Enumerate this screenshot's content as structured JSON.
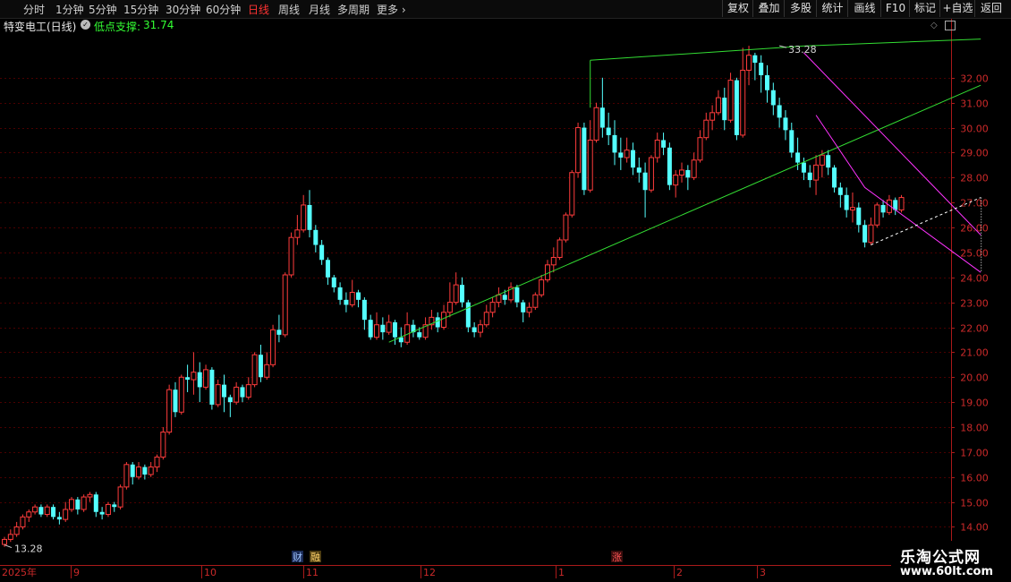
{
  "periods": [
    {
      "label": "分时",
      "active": false
    },
    {
      "label": "1分钟",
      "active": false
    },
    {
      "label": "5分钟",
      "active": false
    },
    {
      "label": "15分钟",
      "active": false
    },
    {
      "label": "30分钟",
      "active": false
    },
    {
      "label": "60分钟",
      "active": false
    },
    {
      "label": "日线",
      "active": true
    },
    {
      "label": "周线",
      "active": false
    },
    {
      "label": "月线",
      "active": false
    },
    {
      "label": "多周期",
      "active": false
    },
    {
      "label": "更多",
      "active": false
    }
  ],
  "toolbar": [
    "复权",
    "叠加",
    "多股",
    "统计",
    "画线",
    "F10",
    "标记",
    "+自选",
    "返回"
  ],
  "title": {
    "stock": "特变电工(日线)",
    "indicator_label": "低点支撑:",
    "indicator_value": "31.74"
  },
  "colors": {
    "up": "#ff3c3c",
    "down": "#54ffff",
    "trend": "#33dd33",
    "channel": "#ff33ff",
    "grid": "#4a0000",
    "axis": "#aa1a1a",
    "axis_text": "#cc2a2a",
    "active_period": "#ff3333"
  },
  "annotations": {
    "high_label": "33.28",
    "low_label": "13.28",
    "event_cai": "财",
    "event_rong": "融",
    "event_zhang": "涨"
  },
  "watermark": {
    "line1": "乐淘公式网",
    "line2": "www.60lt.com"
  },
  "chart_data": {
    "type": "candlestick",
    "ylim": [
      13.3,
      33.5
    ],
    "yticks": [
      14.0,
      15.0,
      16.0,
      17.0,
      18.0,
      19.0,
      20.0,
      21.0,
      22.0,
      23.0,
      24.0,
      25.0,
      26.0,
      27.0,
      28.0,
      29.0,
      30.0,
      31.0,
      32.0
    ],
    "x_labels": [
      "2025年",
      "9",
      "10",
      "11",
      "12",
      "1",
      "2",
      "3"
    ],
    "high": 33.28,
    "low": 13.28,
    "candles": [
      [
        13.3,
        13.5,
        13.2,
        13.6
      ],
      [
        13.5,
        13.7,
        13.4,
        13.9
      ],
      [
        13.7,
        14.0,
        13.6,
        14.2
      ],
      [
        14.0,
        14.4,
        13.9,
        14.5
      ],
      [
        14.4,
        14.6,
        14.2,
        14.7
      ],
      [
        14.6,
        14.8,
        14.5,
        14.9
      ],
      [
        14.8,
        14.5,
        14.4,
        14.9
      ],
      [
        14.5,
        14.8,
        14.4,
        14.9
      ],
      [
        14.8,
        14.4,
        14.3,
        14.9
      ],
      [
        14.4,
        14.3,
        14.1,
        14.6
      ],
      [
        14.3,
        14.7,
        14.2,
        15.0
      ],
      [
        14.7,
        15.1,
        14.6,
        15.2
      ],
      [
        15.1,
        14.7,
        14.5,
        15.2
      ],
      [
        14.7,
        15.2,
        14.6,
        15.3
      ],
      [
        15.2,
        15.3,
        15.0,
        15.4
      ],
      [
        15.3,
        14.6,
        14.4,
        15.4
      ],
      [
        14.6,
        14.5,
        14.3,
        14.8
      ],
      [
        14.5,
        14.9,
        14.4,
        15.0
      ],
      [
        14.9,
        14.8,
        14.6,
        15.0
      ],
      [
        14.8,
        15.6,
        14.7,
        15.7
      ],
      [
        15.6,
        16.5,
        15.5,
        16.6
      ],
      [
        16.5,
        16.0,
        15.7,
        16.6
      ],
      [
        16.0,
        16.4,
        15.9,
        16.6
      ],
      [
        16.4,
        16.1,
        15.9,
        16.5
      ],
      [
        16.1,
        16.4,
        16.0,
        16.6
      ],
      [
        16.4,
        16.8,
        16.2,
        16.9
      ],
      [
        16.8,
        17.8,
        16.7,
        18.0
      ],
      [
        17.8,
        19.5,
        17.7,
        19.7
      ],
      [
        19.5,
        18.6,
        18.4,
        19.8
      ],
      [
        18.6,
        20.0,
        18.5,
        20.1
      ],
      [
        20.0,
        19.9,
        19.4,
        20.5
      ],
      [
        19.9,
        20.2,
        19.3,
        21.0
      ],
      [
        20.2,
        19.6,
        19.0,
        20.6
      ],
      [
        19.6,
        20.3,
        19.5,
        20.5
      ],
      [
        20.3,
        18.9,
        18.7,
        20.4
      ],
      [
        18.9,
        19.7,
        18.8,
        19.9
      ],
      [
        19.7,
        19.2,
        18.6,
        20.1
      ],
      [
        19.2,
        19.0,
        18.4,
        19.3
      ],
      [
        19.0,
        19.6,
        18.9,
        19.8
      ],
      [
        19.6,
        19.2,
        19.0,
        19.7
      ],
      [
        19.2,
        19.7,
        19.1,
        20.0
      ],
      [
        19.7,
        20.9,
        19.6,
        21.0
      ],
      [
        20.9,
        20.0,
        19.8,
        21.3
      ],
      [
        20.0,
        20.5,
        19.9,
        21.0
      ],
      [
        20.5,
        21.9,
        20.4,
        22.1
      ],
      [
        21.9,
        21.7,
        21.4,
        22.5
      ],
      [
        21.7,
        24.1,
        21.6,
        24.2
      ],
      [
        24.1,
        25.6,
        24.0,
        25.8
      ],
      [
        25.6,
        25.9,
        25.3,
        26.5
      ],
      [
        25.9,
        26.9,
        25.8,
        27.3
      ],
      [
        26.9,
        25.9,
        25.6,
        27.5
      ],
      [
        25.9,
        25.3,
        25.0,
        26.1
      ],
      [
        25.3,
        24.7,
        24.5,
        25.5
      ],
      [
        24.7,
        24.0,
        23.7,
        24.8
      ],
      [
        24.0,
        23.6,
        23.4,
        24.1
      ],
      [
        23.6,
        23.1,
        22.9,
        23.8
      ],
      [
        23.1,
        22.9,
        22.6,
        23.4
      ],
      [
        22.9,
        23.4,
        22.8,
        23.9
      ],
      [
        23.4,
        23.1,
        22.8,
        23.5
      ],
      [
        23.1,
        22.3,
        21.9,
        23.2
      ],
      [
        22.3,
        21.6,
        21.5,
        22.5
      ],
      [
        21.6,
        22.1,
        21.5,
        22.6
      ],
      [
        22.1,
        21.8,
        21.5,
        22.4
      ],
      [
        21.8,
        22.2,
        21.7,
        22.5
      ],
      [
        22.2,
        21.6,
        21.3,
        22.3
      ],
      [
        21.6,
        21.4,
        21.2,
        22.0
      ],
      [
        21.4,
        22.1,
        21.3,
        22.6
      ],
      [
        22.1,
        21.8,
        21.6,
        22.3
      ],
      [
        21.8,
        21.6,
        21.5,
        22.0
      ],
      [
        21.6,
        22.1,
        21.5,
        22.4
      ],
      [
        22.1,
        22.4,
        21.9,
        22.7
      ],
      [
        22.4,
        22.0,
        21.8,
        22.6
      ],
      [
        22.0,
        22.6,
        21.9,
        22.9
      ],
      [
        22.6,
        23.0,
        22.4,
        23.8
      ],
      [
        23.0,
        23.7,
        22.9,
        24.2
      ],
      [
        23.7,
        23.0,
        22.8,
        24.0
      ],
      [
        23.0,
        22.0,
        21.8,
        23.1
      ],
      [
        22.0,
        21.8,
        21.6,
        22.2
      ],
      [
        21.8,
        22.1,
        21.6,
        22.3
      ],
      [
        22.1,
        22.6,
        22.0,
        22.9
      ],
      [
        22.6,
        23.0,
        22.4,
        23.2
      ],
      [
        23.0,
        23.3,
        22.8,
        23.6
      ],
      [
        23.3,
        23.1,
        22.9,
        23.5
      ],
      [
        23.1,
        23.6,
        23.0,
        23.8
      ],
      [
        23.6,
        23.0,
        22.8,
        23.7
      ],
      [
        23.0,
        22.6,
        22.2,
        23.1
      ],
      [
        22.6,
        22.8,
        22.4,
        23.0
      ],
      [
        22.8,
        23.3,
        22.7,
        23.4
      ],
      [
        23.3,
        23.9,
        23.2,
        24.1
      ],
      [
        23.9,
        24.5,
        23.8,
        24.7
      ],
      [
        24.5,
        24.8,
        24.2,
        25.2
      ],
      [
        24.8,
        25.5,
        24.7,
        25.6
      ],
      [
        25.5,
        26.5,
        25.4,
        26.6
      ],
      [
        26.5,
        28.2,
        26.4,
        28.3
      ],
      [
        28.2,
        30.0,
        28.0,
        30.2
      ],
      [
        30.0,
        27.5,
        27.3,
        30.2
      ],
      [
        27.5,
        29.5,
        27.4,
        30.3
      ],
      [
        29.5,
        30.8,
        29.4,
        31.0
      ],
      [
        30.8,
        30.0,
        29.6,
        32.0
      ],
      [
        30.0,
        29.7,
        29.3,
        30.6
      ],
      [
        29.7,
        29.0,
        28.5,
        30.3
      ],
      [
        29.0,
        28.8,
        28.3,
        29.6
      ],
      [
        28.8,
        29.1,
        28.6,
        29.6
      ],
      [
        29.1,
        28.4,
        28.1,
        29.4
      ],
      [
        28.4,
        28.2,
        27.8,
        28.8
      ],
      [
        28.2,
        27.5,
        26.4,
        28.6
      ],
      [
        27.5,
        28.8,
        27.4,
        28.9
      ],
      [
        28.8,
        29.5,
        28.6,
        29.8
      ],
      [
        29.5,
        29.2,
        28.9,
        29.8
      ],
      [
        29.2,
        27.7,
        27.5,
        29.4
      ],
      [
        27.7,
        28.1,
        27.2,
        28.3
      ],
      [
        28.1,
        28.3,
        27.8,
        28.6
      ],
      [
        28.3,
        28.0,
        27.5,
        28.5
      ],
      [
        28.0,
        28.7,
        27.9,
        29.0
      ],
      [
        28.7,
        29.6,
        28.6,
        29.9
      ],
      [
        29.6,
        30.3,
        29.5,
        30.6
      ],
      [
        30.3,
        30.6,
        29.9,
        30.9
      ],
      [
        30.6,
        31.2,
        30.5,
        31.5
      ],
      [
        31.2,
        30.3,
        29.9,
        31.6
      ],
      [
        30.3,
        31.9,
        30.2,
        32.2
      ],
      [
        31.9,
        29.7,
        29.5,
        32.0
      ],
      [
        29.7,
        32.3,
        29.6,
        33.2
      ],
      [
        32.3,
        32.9,
        31.7,
        33.28
      ],
      [
        32.9,
        32.6,
        31.9,
        33.0
      ],
      [
        32.6,
        32.1,
        31.4,
        32.9
      ],
      [
        32.1,
        31.5,
        31.0,
        32.5
      ],
      [
        31.5,
        30.9,
        30.5,
        31.8
      ],
      [
        30.9,
        30.4,
        30.0,
        31.2
      ],
      [
        30.4,
        29.9,
        29.5,
        30.7
      ],
      [
        29.9,
        29.0,
        28.8,
        30.2
      ],
      [
        29.0,
        28.6,
        28.3,
        29.6
      ],
      [
        28.6,
        28.2,
        27.9,
        28.8
      ],
      [
        28.2,
        27.9,
        27.6,
        28.5
      ],
      [
        27.9,
        28.5,
        27.3,
        28.9
      ],
      [
        28.5,
        28.9,
        28.0,
        29.1
      ],
      [
        28.9,
        28.4,
        28.1,
        29.1
      ],
      [
        28.4,
        27.6,
        27.4,
        28.5
      ],
      [
        27.6,
        27.3,
        26.8,
        27.8
      ],
      [
        27.3,
        26.7,
        26.4,
        27.6
      ],
      [
        26.7,
        26.8,
        26.2,
        27.4
      ],
      [
        26.8,
        26.1,
        25.8,
        27.0
      ],
      [
        26.1,
        25.4,
        25.2,
        26.3
      ],
      [
        25.4,
        26.1,
        25.3,
        26.4
      ],
      [
        26.1,
        26.9,
        26.0,
        27.0
      ],
      [
        26.9,
        26.6,
        26.4,
        27.1
      ],
      [
        26.6,
        27.1,
        26.5,
        27.3
      ],
      [
        27.1,
        26.7,
        26.5,
        27.2
      ],
      [
        26.7,
        27.2,
        26.6,
        27.3
      ]
    ],
    "lines": [
      {
        "name": "support",
        "color": "trend",
        "points": [
          [
            63,
            21.4
          ],
          [
            160,
            31.7
          ]
        ]
      },
      {
        "name": "top",
        "color": "trend",
        "points": [
          [
            96,
            32.7
          ],
          [
            131,
            33.27
          ],
          [
            160,
            33.55
          ]
        ]
      },
      {
        "name": "channel_upper",
        "color": "channel",
        "points": [
          [
            131,
            33.0
          ],
          [
            160,
            25.7
          ]
        ]
      },
      {
        "name": "channel_lower",
        "color": "channel",
        "points": [
          [
            133,
            30.5
          ],
          [
            141,
            27.6
          ],
          [
            160,
            24.2
          ]
        ]
      },
      {
        "name": "projection",
        "color": "dashed",
        "points": [
          [
            142,
            25.3
          ],
          [
            160,
            27.2
          ]
        ]
      }
    ]
  }
}
